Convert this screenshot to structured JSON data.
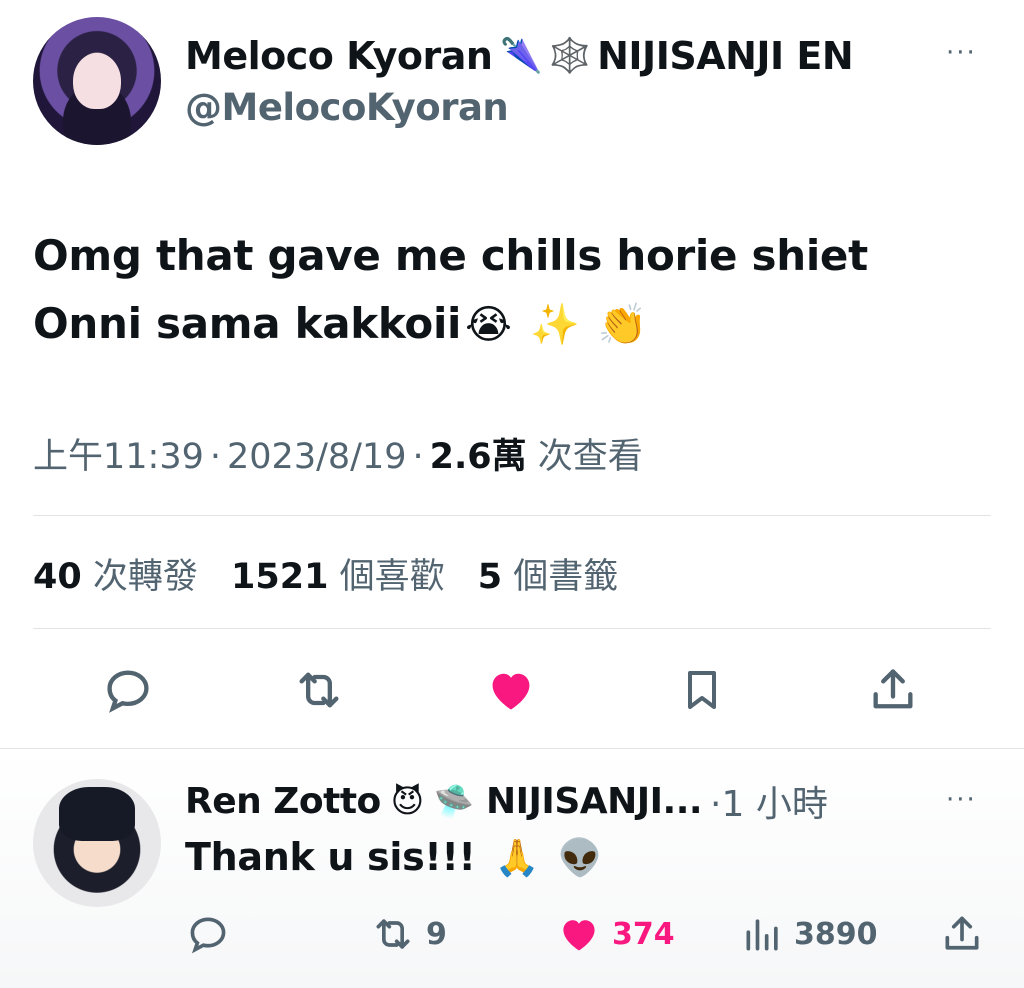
{
  "tweet": {
    "display_name": "Meloco Kyoran",
    "name_emoji_1": "🌂",
    "name_emoji_2": "🕸️",
    "name_suffix": "NIJISANJI EN",
    "handle": "@MelocoKyoran",
    "more_label": "···",
    "text_line1": "Omg that gave me chills horie shiet",
    "text_line2": "Onni sama kakkoii",
    "text_emojis": [
      "😭",
      "✨",
      "👏"
    ],
    "time": "上午11:39",
    "date": "2023/8/19",
    "views_count": "2.6萬",
    "views_label": "次查看",
    "retweets_count": "40",
    "retweets_label": "次轉發",
    "likes_count": "1521",
    "likes_label": "個喜歡",
    "bookmarks_count": "5",
    "bookmarks_label": "個書籤",
    "actions": [
      "reply-icon",
      "retweet-icon",
      "like-icon-filled",
      "bookmark-icon",
      "share-icon"
    ],
    "like_color": "#f91880"
  },
  "reply": {
    "display_name": "Ren Zotto",
    "name_emoji_1": "😈",
    "name_emoji_2": "🛸",
    "name_suffix": "NIJISANJI...",
    "time": "·1 小時",
    "more_label": "···",
    "text": "Thank u sis!!!",
    "text_emojis": [
      "🙏",
      "👽"
    ],
    "retweets": "9",
    "likes": "374",
    "views": "3890"
  },
  "colors": {
    "text_primary": "#0f1419",
    "text_secondary": "#536471",
    "like_pink": "#f91880",
    "divider": "#e1e5e8"
  }
}
